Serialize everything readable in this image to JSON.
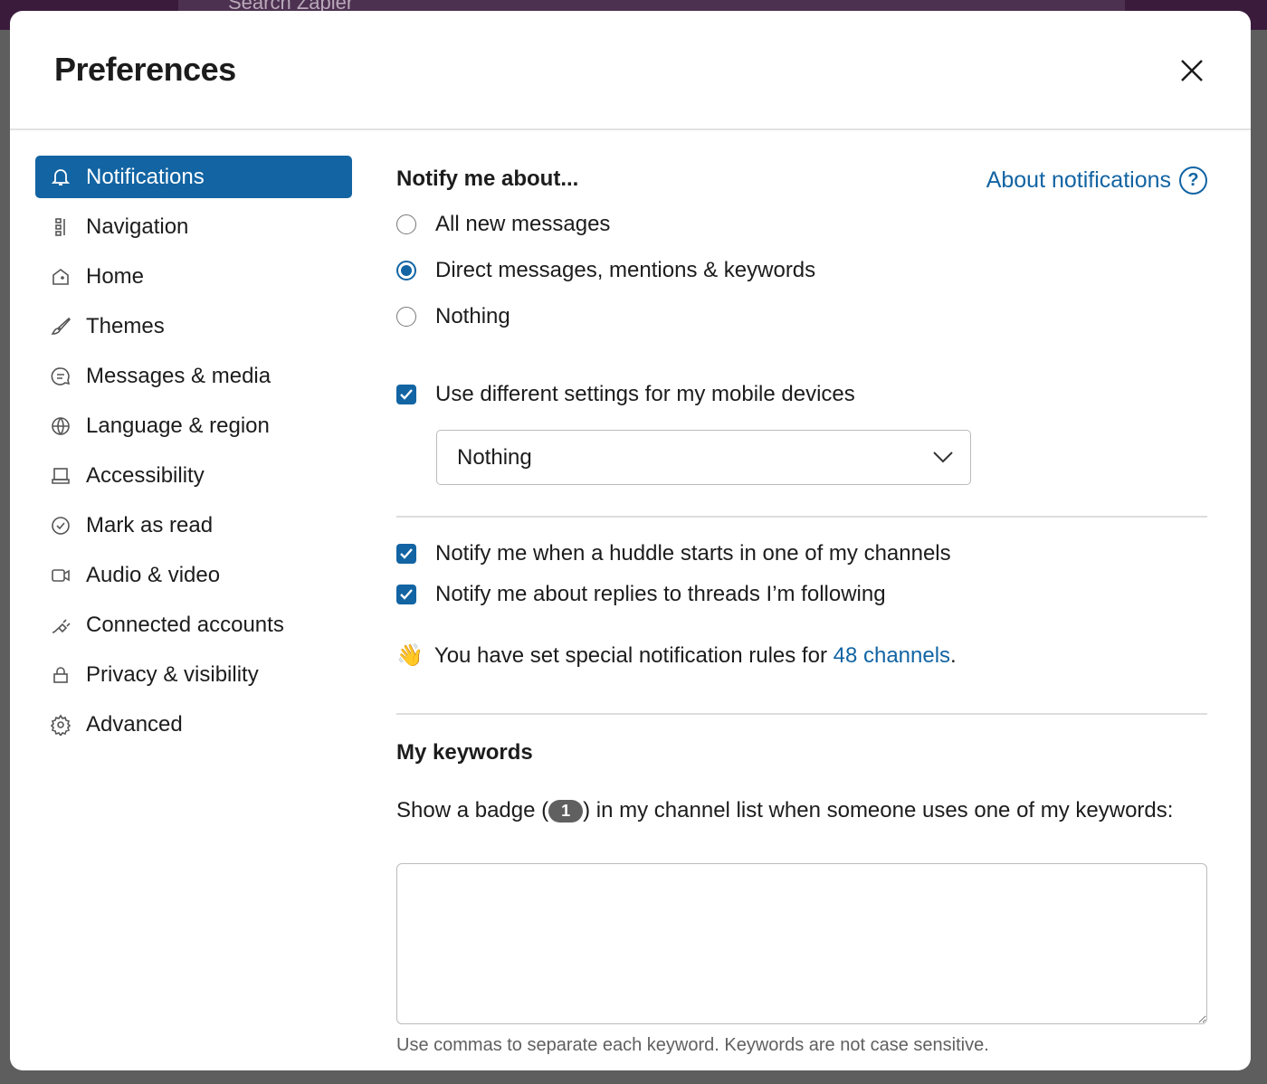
{
  "background": {
    "search_placeholder": "Search Zapier"
  },
  "modal": {
    "title": "Preferences"
  },
  "sidebar": {
    "items": [
      {
        "label": "Notifications",
        "icon": "bell-icon",
        "active": true
      },
      {
        "label": "Navigation",
        "icon": "navigation-icon"
      },
      {
        "label": "Home",
        "icon": "home-icon"
      },
      {
        "label": "Themes",
        "icon": "paintbrush-icon"
      },
      {
        "label": "Messages & media",
        "icon": "message-icon"
      },
      {
        "label": "Language & region",
        "icon": "globe-icon"
      },
      {
        "label": "Accessibility",
        "icon": "laptop-icon"
      },
      {
        "label": "Mark as read",
        "icon": "check-circle-icon"
      },
      {
        "label": "Audio & video",
        "icon": "video-icon"
      },
      {
        "label": "Connected accounts",
        "icon": "plug-icon"
      },
      {
        "label": "Privacy & visibility",
        "icon": "lock-icon"
      },
      {
        "label": "Advanced",
        "icon": "gear-icon"
      }
    ]
  },
  "notify": {
    "heading": "Notify me about...",
    "about_link": "About notifications",
    "options": [
      {
        "label": "All new messages",
        "selected": false
      },
      {
        "label": "Direct messages, mentions & keywords",
        "selected": true
      },
      {
        "label": "Nothing",
        "selected": false
      }
    ],
    "mobile_checkbox": {
      "label": "Use different settings for my mobile devices",
      "checked": true
    },
    "mobile_select": {
      "value": "Nothing"
    },
    "huddle_checkbox": {
      "label": "Notify me when a huddle starts in one of my channels",
      "checked": true
    },
    "threads_checkbox": {
      "label": "Notify me about replies to threads I’m following",
      "checked": true
    },
    "special": {
      "emoji": "👋",
      "text": "You have set special notification rules for ",
      "link": "48 channels",
      "suffix": "."
    }
  },
  "keywords": {
    "heading": "My keywords",
    "desc_before": "Show a badge (",
    "badge": "1",
    "desc_after": ") in my channel list when someone uses one of my keywords:",
    "value": "",
    "hint": "Use commas to separate each keyword. Keywords are not case sensitive."
  },
  "colors": {
    "accent": "#1264a3",
    "topbar": "#3a1b3c"
  }
}
